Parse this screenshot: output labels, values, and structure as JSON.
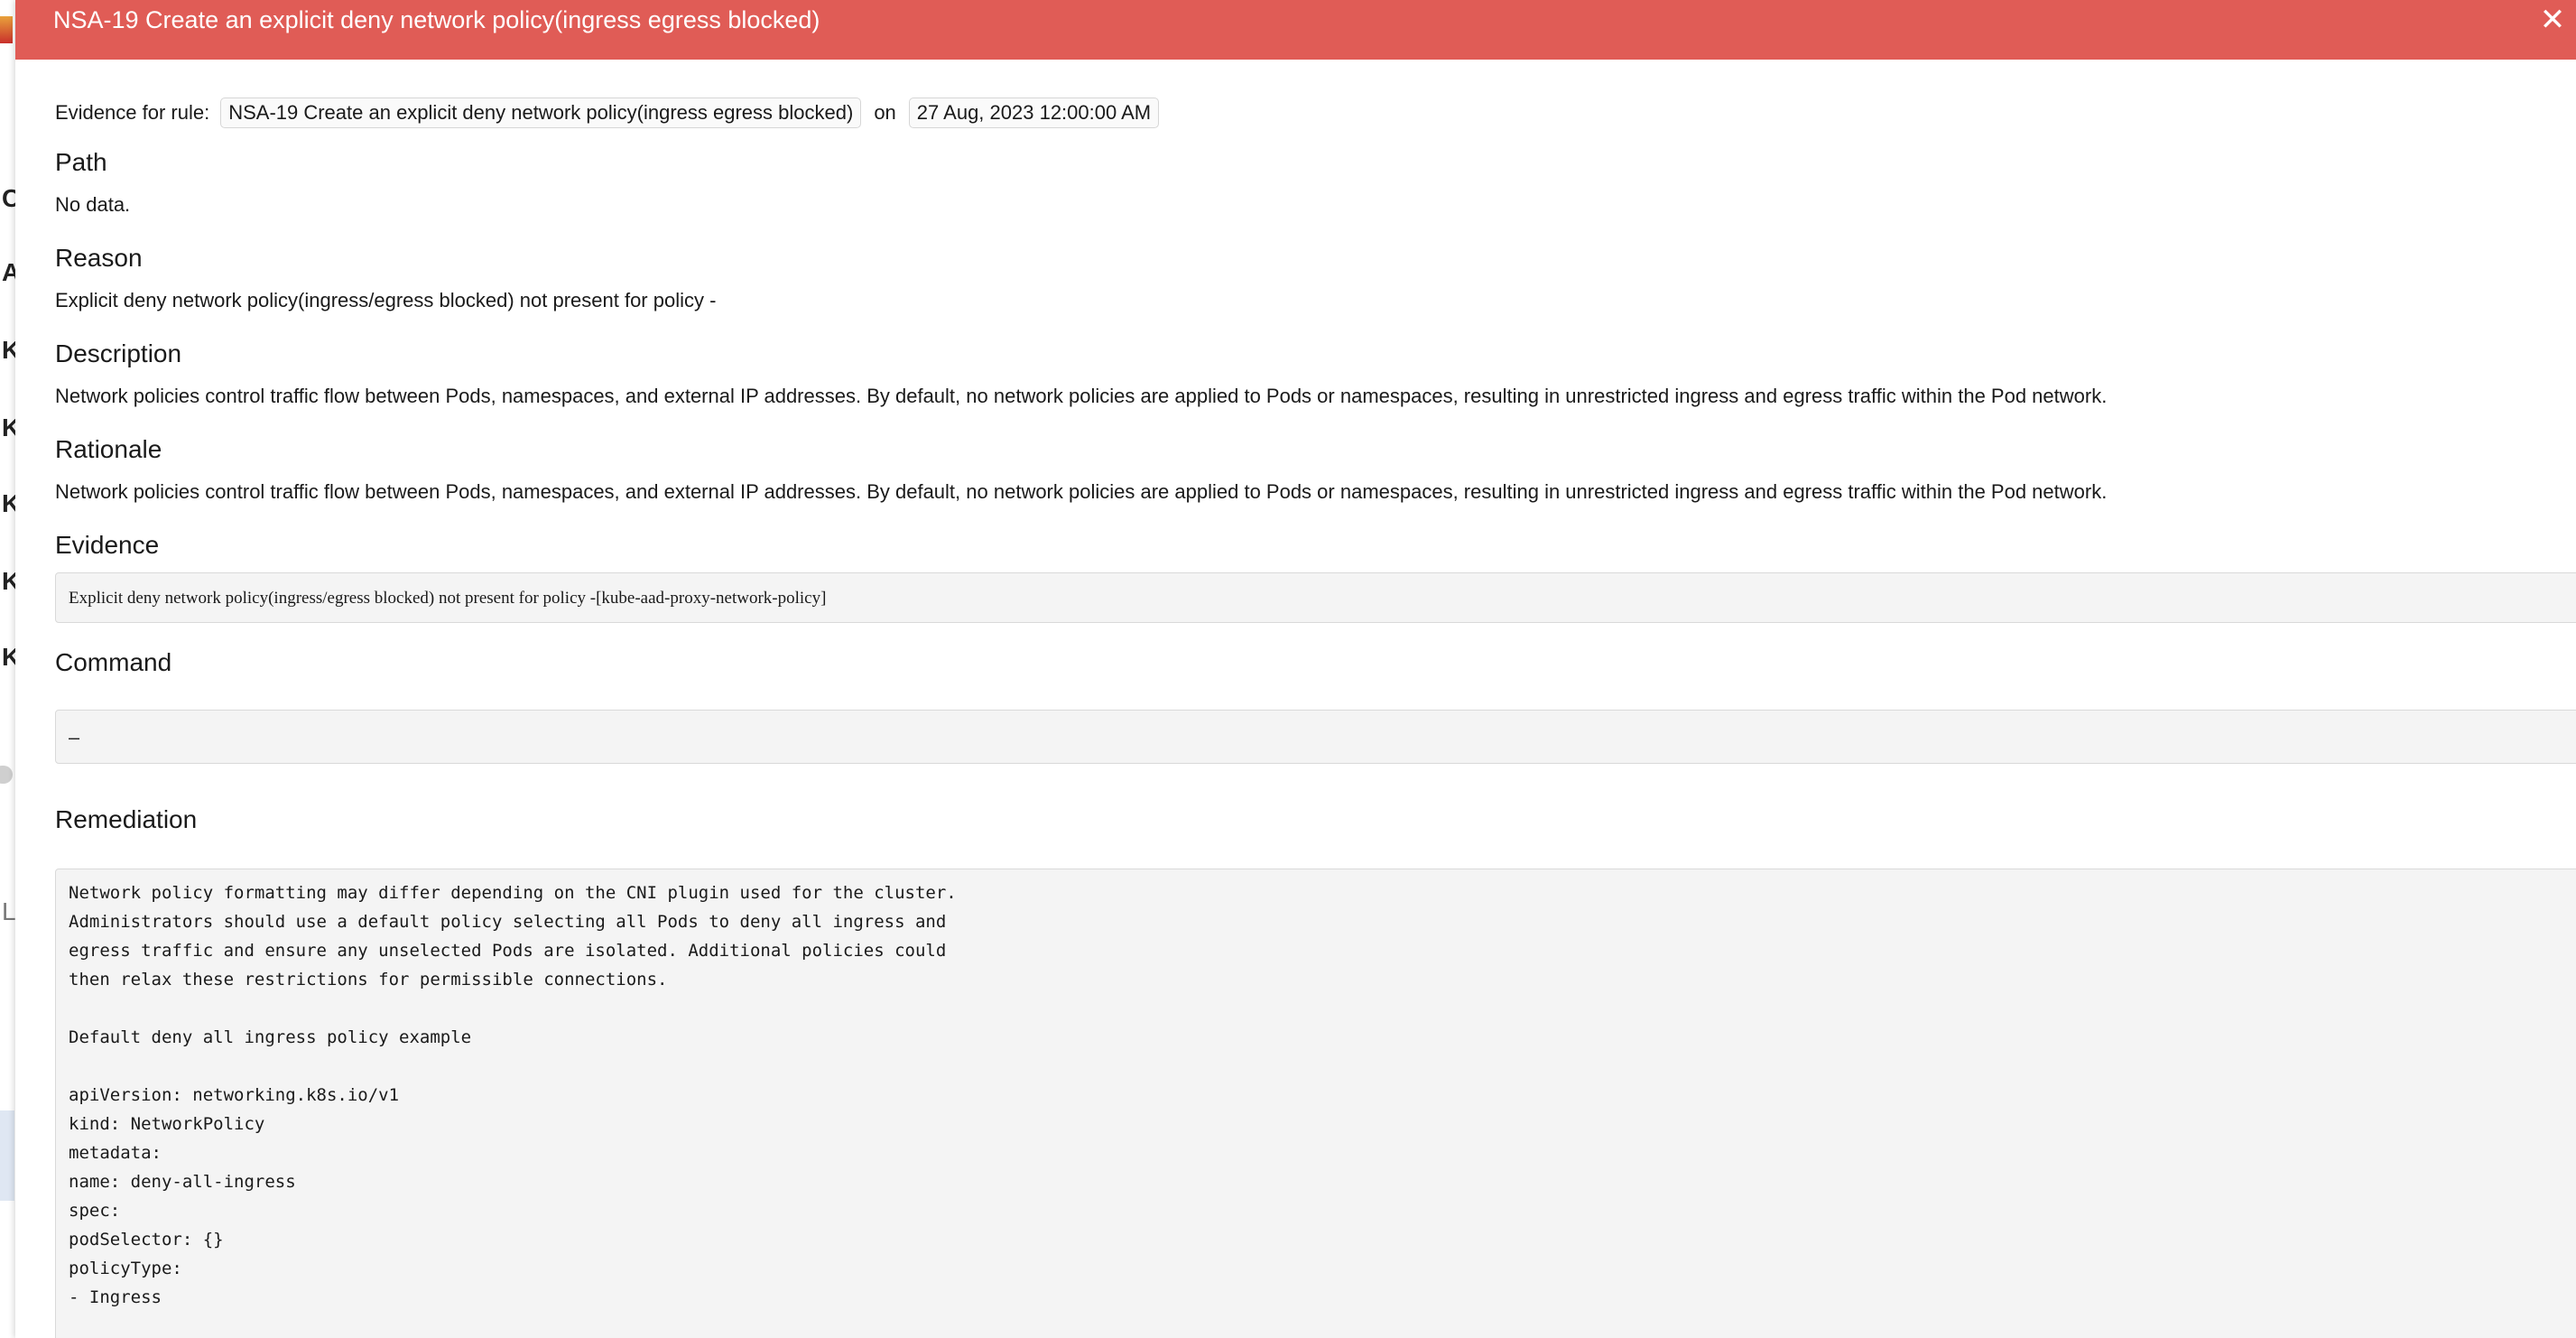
{
  "modal": {
    "title": "NSA-19 Create an explicit deny network policy(ingress egress blocked)",
    "close_glyph": "✕"
  },
  "evidence_for_rule": {
    "label": "Evidence for rule:",
    "rule": "NSA-19 Create an explicit deny network policy(ingress egress blocked)",
    "on_label": "on",
    "date": "27 Aug, 2023 12:00:00 AM"
  },
  "path": {
    "title": "Path",
    "value": "No data."
  },
  "reason": {
    "title": "Reason",
    "value": "Explicit deny network policy(ingress/egress blocked) not present for policy -"
  },
  "description": {
    "title": "Description",
    "value": "Network policies control traffic flow between Pods, namespaces, and external IP addresses. By default, no network policies are applied to Pods or namespaces, resulting in unrestricted ingress and egress traffic within the Pod network."
  },
  "rationale": {
    "title": "Rationale",
    "value": "Network policies control traffic flow between Pods, namespaces, and external IP addresses. By default, no network policies are applied to Pods or namespaces, resulting in unrestricted ingress and egress traffic within the Pod network."
  },
  "evidence": {
    "title": "Evidence",
    "value": "Explicit deny network policy(ingress/egress blocked) not present for policy -[kube-aad-proxy-network-policy]"
  },
  "command": {
    "title": "Command",
    "value": "–"
  },
  "remediation": {
    "title": "Remediation",
    "value": "Network policy formatting may differ depending on the CNI plugin used for the cluster.\nAdministrators should use a default policy selecting all Pods to deny all ingress and\negress traffic and ensure any unselected Pods are isolated. Additional policies could\nthen relax these restrictions for permissible connections.\n\nDefault deny all ingress policy example\n\napiVersion: networking.k8s.io/v1\nkind: NetworkPolicy\nmetadata:\nname: deny-all-ingress\nspec:\npodSelector: {}\npolicyType:\n- Ingress"
  },
  "backdrop": {
    "letters": [
      "C",
      "A",
      "K",
      "K",
      "K",
      "K",
      "K",
      "L"
    ]
  },
  "colors": {
    "header": "#e05c56",
    "box_background": "#f4f4f4"
  }
}
